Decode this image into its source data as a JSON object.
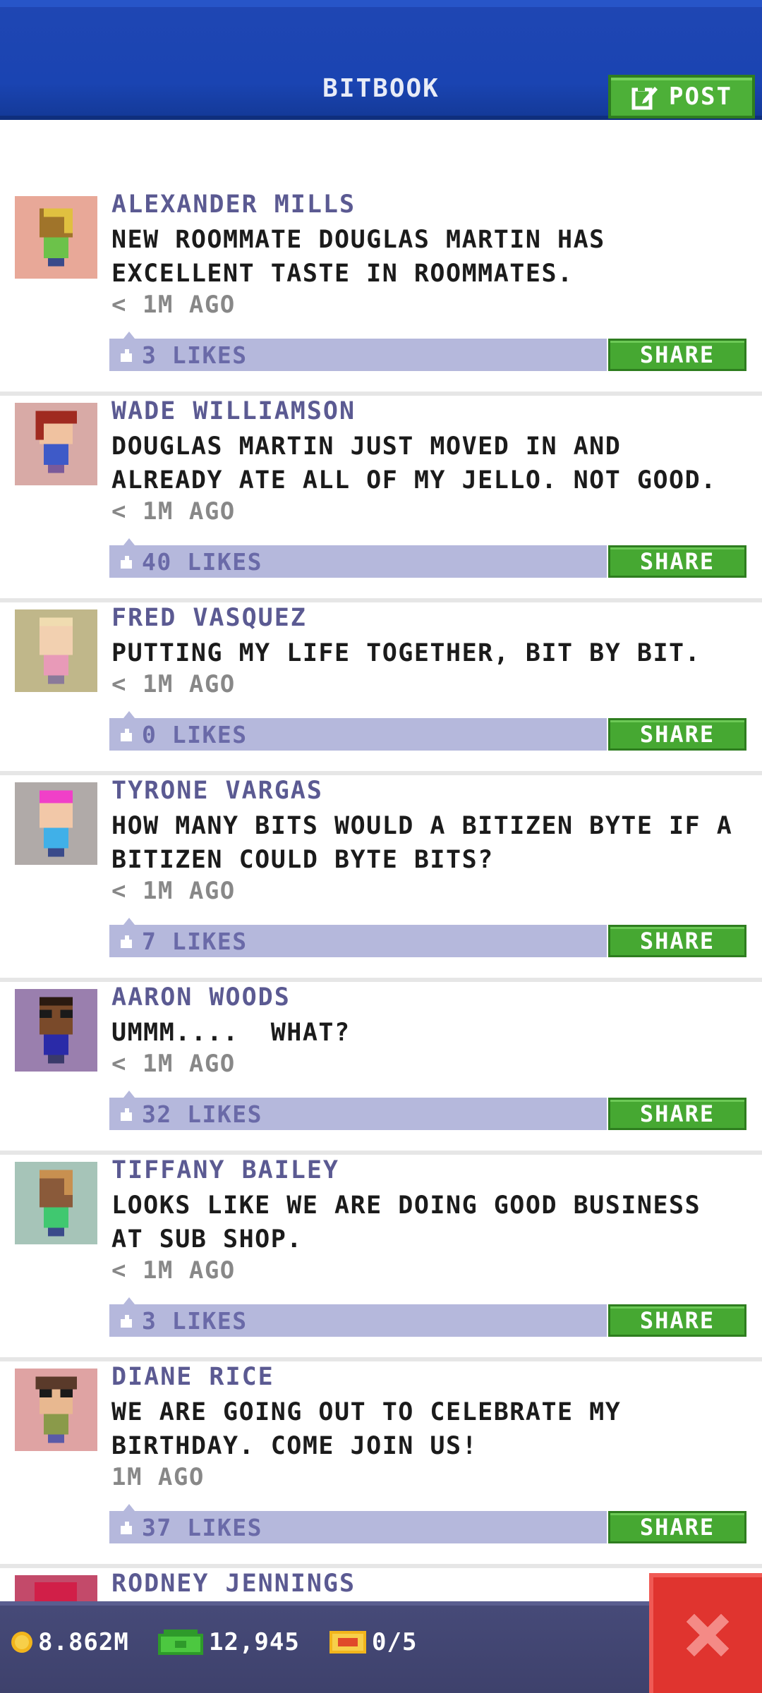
{
  "header": {
    "title": "BITBOOK",
    "post_label": "POST"
  },
  "posts": [
    {
      "name": "ALEXANDER MILLS",
      "text": "NEW ROOMMATE DOUGLAS MARTIN HAS\nEXCELLENT TASTE IN ROOMMATES.",
      "time": "< 1M AGO",
      "likes": "3 LIKES",
      "share": "SHARE",
      "avatar_bg": "#e8a898"
    },
    {
      "name": "WADE WILLIAMSON",
      "text": "DOUGLAS MARTIN JUST MOVED IN AND\nALREADY ATE ALL OF MY JELLO. NOT GOOD.",
      "time": "< 1M AGO",
      "likes": "40 LIKES",
      "share": "SHARE",
      "avatar_bg": "#d8aaa6"
    },
    {
      "name": "FRED VASQUEZ",
      "text": "PUTTING MY LIFE TOGETHER, BIT BY BIT.",
      "time": "< 1M AGO",
      "likes": "0 LIKES",
      "share": "SHARE",
      "avatar_bg": "#c0b78a"
    },
    {
      "name": "TYRONE VARGAS",
      "text": "HOW MANY BITS WOULD A BITIZEN BYTE IF A\nBITIZEN COULD BYTE BITS?",
      "time": "< 1M AGO",
      "likes": "7 LIKES",
      "share": "SHARE",
      "avatar_bg": "#b0aaa8"
    },
    {
      "name": "AARON WOODS",
      "text": "UMMM....  WHAT?",
      "time": "< 1M AGO",
      "likes": "32 LIKES",
      "share": "SHARE",
      "avatar_bg": "#9a7fae"
    },
    {
      "name": "TIFFANY BAILEY",
      "text": "LOOKS LIKE WE ARE DOING GOOD BUSINESS\nAT SUB SHOP.",
      "time": "< 1M AGO",
      "likes": "3 LIKES",
      "share": "SHARE",
      "avatar_bg": "#a6c4b8"
    },
    {
      "name": "DIANE RICE",
      "text": "WE ARE GOING OUT TO CELEBRATE MY\nBIRTHDAY. COME JOIN US!",
      "time": "1M AGO",
      "likes": "37 LIKES",
      "share": "SHARE",
      "avatar_bg": "#dfa3a3"
    }
  ],
  "partial_post": {
    "name": "RODNEY JENNINGS"
  },
  "status_bar": {
    "coins": "8.862M",
    "bux": "12,945",
    "tickets": "0/5"
  },
  "colors": {
    "header_blue": "#1a44b2",
    "share_green": "#46a832",
    "like_bar": "#b5b8dc",
    "name_purple": "#5b5a92",
    "close_red": "#e0342f"
  }
}
